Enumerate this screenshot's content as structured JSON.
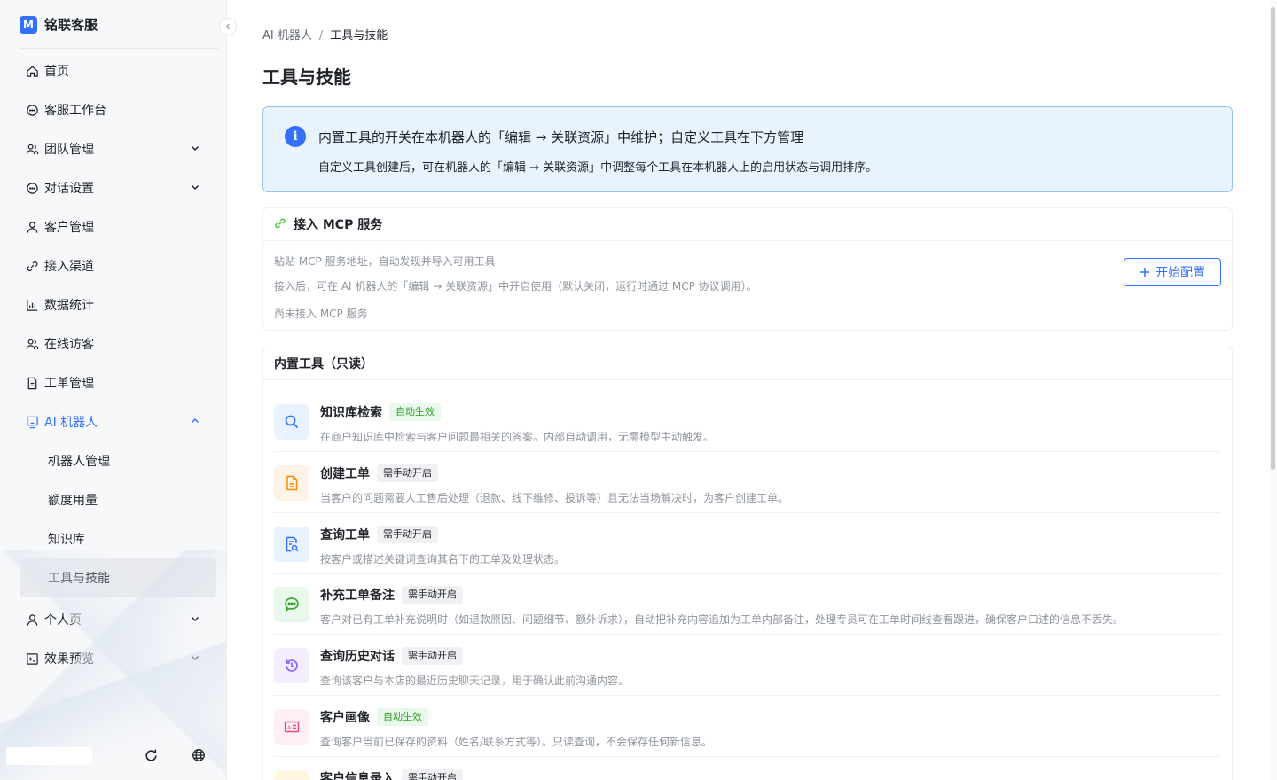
{
  "brand": {
    "logo_text": "M",
    "name": "铭联客服"
  },
  "nav": {
    "items": [
      {
        "label": "首页"
      },
      {
        "label": "客服工作台"
      },
      {
        "label": "团队管理"
      },
      {
        "label": "对话设置"
      },
      {
        "label": "客户管理"
      },
      {
        "label": "接入渠道"
      },
      {
        "label": "数据统计"
      },
      {
        "label": "在线访客"
      },
      {
        "label": "工单管理"
      },
      {
        "label": "AI 机器人"
      },
      {
        "label": "个人页"
      },
      {
        "label": "效果预览"
      }
    ],
    "ai_children": [
      {
        "label": "机器人管理"
      },
      {
        "label": "额度用量"
      },
      {
        "label": "知识库"
      },
      {
        "label": "工具与技能"
      }
    ]
  },
  "breadcrumb": {
    "parent": "AI 机器人",
    "separator": "/",
    "current": "工具与技能"
  },
  "page_title": "工具与技能",
  "notice": {
    "icon": "i",
    "title": "内置工具的开关在本机器人的「编辑 → 关联资源」中维护；自定义工具在下方管理",
    "desc": "自定义工具创建后，可在机器人的「编辑 → 关联资源」中调整每个工具在本机器人上的启用状态与调用排序。"
  },
  "mcp": {
    "title": "接入 MCP 服务",
    "line1": "粘贴 MCP 服务地址，自动发现并导入可用工具",
    "line2": "接入后，可在 AI 机器人的「编辑 → 关联资源」中开启使用（默认关闭，运行时通过 MCP 协议调用）。",
    "status": "尚未接入 MCP 服务",
    "button_label": "开始配置"
  },
  "tools": {
    "title": "内置工具（只读）",
    "items": [
      {
        "name": "知识库检索",
        "tag": "自动生效",
        "desc": "在商户知识库中检索与客户问题最相关的答案。内部自动调用，无需模型主动触发。"
      },
      {
        "name": "创建工单",
        "tag": "需手动开启",
        "desc": "当客户的问题需要人工售后处理（退款、线下维修、投诉等）且无法当场解决时，为客户创建工单。"
      },
      {
        "name": "查询工单",
        "tag": "需手动开启",
        "desc": "按客户或描述关键词查询其名下的工单及处理状态。"
      },
      {
        "name": "补充工单备注",
        "tag": "需手动开启",
        "desc": "客户对已有工单补充说明时（如退款原因、问题细节、额外诉求），自动把补充内容追加为工单内部备注，处理专员可在工单时间线查看跟进，确保客户口述的信息不丢失。"
      },
      {
        "name": "查询历史对话",
        "tag": "需手动开启",
        "desc": "查询该客户与本店的最近历史聊天记录，用于确认此前沟通内容。"
      },
      {
        "name": "客户画像",
        "tag": "自动生效",
        "desc": "查询客户当前已保存的资料（姓名/联系方式等）。只读查询，不会保存任何新信息。"
      },
      {
        "name": "客户信息录入",
        "tag": "需手动开启",
        "desc": ""
      }
    ]
  },
  "colors": {
    "accent": "#3370ff",
    "notice_bg": "#e8f3ff",
    "auto_tag": "#2ea121"
  }
}
